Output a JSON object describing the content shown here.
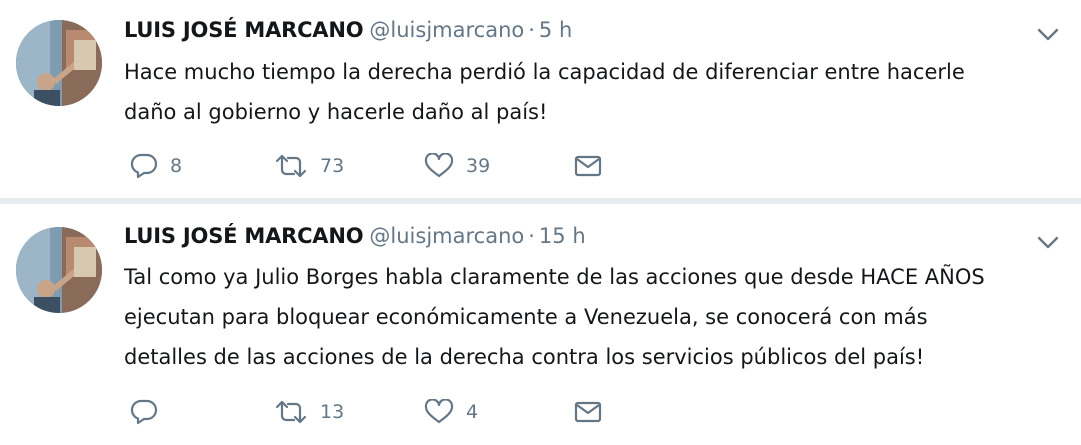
{
  "colors": {
    "text": "#14171a",
    "muted": "#657786",
    "divider": "#e6ecf0"
  },
  "tweets": [
    {
      "name": "LUIS JOSÉ MARCANO",
      "handle": "@luisjmarcano",
      "separator": "·",
      "time": "5 h",
      "text_lines": [
        "Hace mucho tiempo la derecha perdió la capacidad de diferenciar entre hacerle",
        "daño al gobierno y hacerle daño al país!"
      ],
      "replies": "8",
      "retweets": "73",
      "likes": "39",
      "icons": [
        "reply-icon",
        "retweet-icon",
        "heart-icon",
        "envelope-icon",
        "chevron-down-icon"
      ]
    },
    {
      "name": "LUIS JOSÉ MARCANO",
      "handle": "@luisjmarcano",
      "separator": "·",
      "time": "15 h",
      "text_lines": [
        "Tal como ya Julio Borges habla claramente de las acciones que desde HACE AÑOS",
        "ejecutan para bloquear económicamente a Venezuela, se conocerá con más",
        "detalles de las acciones de la derecha contra los servicios públicos del país!"
      ],
      "replies": "",
      "retweets": "13",
      "likes": "4",
      "icons": [
        "reply-icon",
        "retweet-icon",
        "heart-icon",
        "envelope-icon",
        "chevron-down-icon"
      ]
    }
  ]
}
